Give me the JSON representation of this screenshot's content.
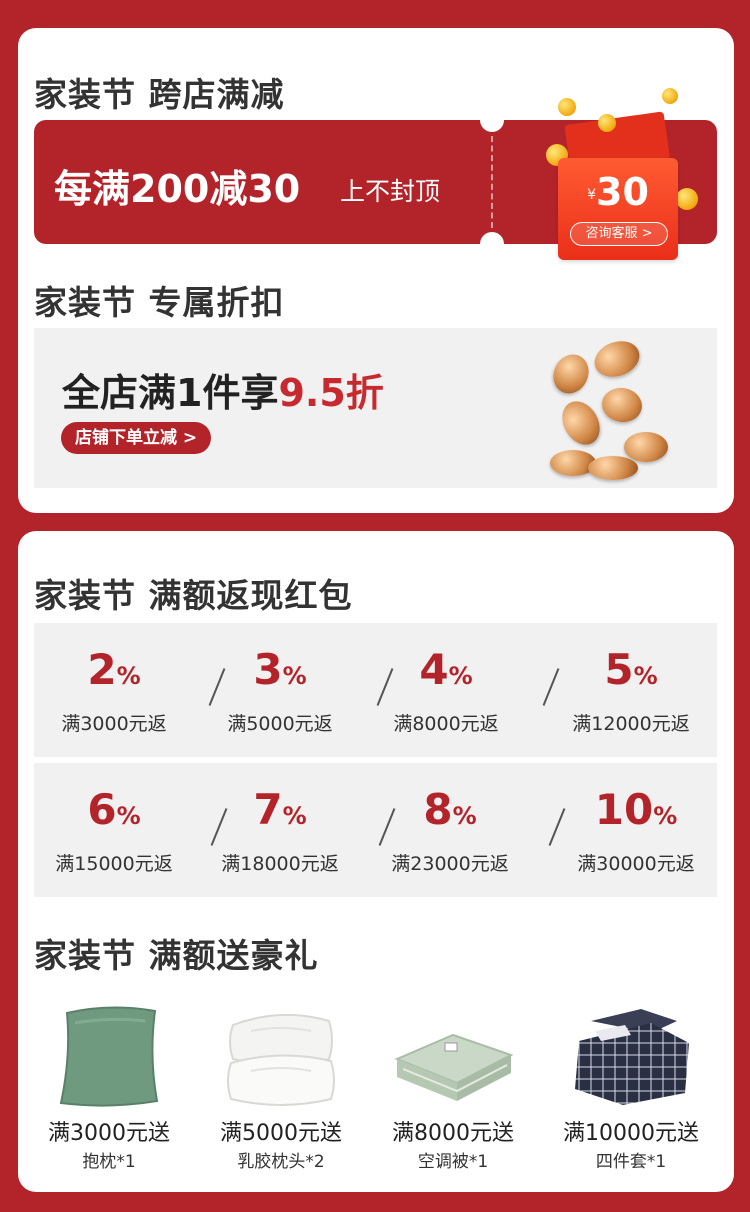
{
  "cross_store": {
    "heading": "家装节 跨店满减",
    "main": "每满200减30",
    "sub": "上不封顶",
    "currency": "¥",
    "amount": "30",
    "consult_label": "咨询客服 >"
  },
  "discount": {
    "heading": "家装节 专属折扣",
    "line_prefix": "全店满1件享",
    "line_highlight": "9.5折",
    "pill_label": "店铺下单立减 >"
  },
  "cashback": {
    "heading": "家装节 满额返现红包",
    "percent_symbol": "%",
    "items": [
      {
        "pct": "2",
        "cond": "满3000元返"
      },
      {
        "pct": "3",
        "cond": "满5000元返"
      },
      {
        "pct": "4",
        "cond": "满8000元返"
      },
      {
        "pct": "5",
        "cond": "满12000元返"
      },
      {
        "pct": "6",
        "cond": "满15000元返"
      },
      {
        "pct": "7",
        "cond": "满18000元返"
      },
      {
        "pct": "8",
        "cond": "满23000元返"
      },
      {
        "pct": "10",
        "cond": "满30000元返"
      }
    ]
  },
  "gifts": {
    "heading": "家装节 满额送豪礼",
    "items": [
      {
        "cond": "满3000元送",
        "item": "抱枕*1",
        "icon": "pillow-icon"
      },
      {
        "cond": "满5000元送",
        "item": "乳胶枕头*2",
        "icon": "latex-pillow-icon"
      },
      {
        "cond": "满8000元送",
        "item": "空调被*1",
        "icon": "quilt-icon"
      },
      {
        "cond": "满10000元送",
        "item": "四件套*1",
        "icon": "bedding-set-icon"
      }
    ]
  },
  "colors": {
    "brand_red": "#b3242a",
    "panel_gray": "#f2f1f1",
    "envelope_red": "#ea2f19"
  }
}
